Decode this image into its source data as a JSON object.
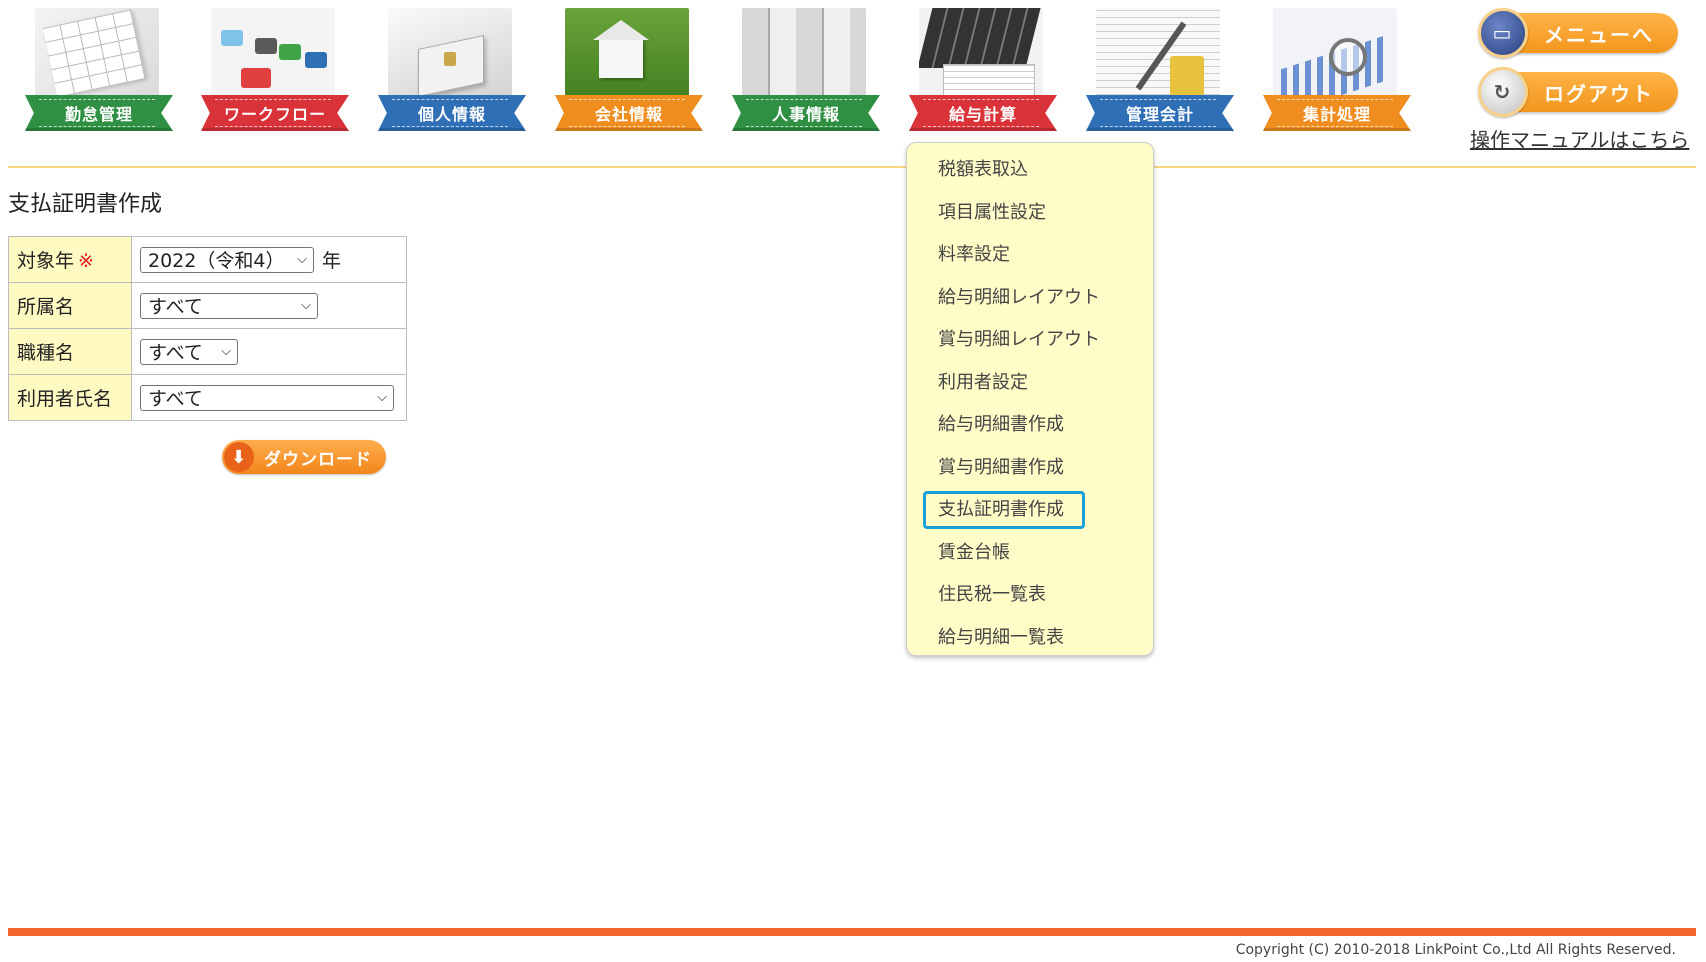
{
  "nav": {
    "tiles": [
      {
        "label": "勤怠管理",
        "color": "#2f8f43",
        "icon": "calendar-icon"
      },
      {
        "label": "ワークフロー",
        "color": "#d93238",
        "icon": "workflow-icon"
      },
      {
        "label": "個人情報",
        "color": "#2f6fb5",
        "icon": "padlock-icon"
      },
      {
        "label": "会社情報",
        "color": "#ef8d1f",
        "icon": "house-icon"
      },
      {
        "label": "人事情報",
        "color": "#2f8f43",
        "icon": "file-cabinet-icon"
      },
      {
        "label": "給与計算",
        "color": "#d93238",
        "icon": "calculator-icon"
      },
      {
        "label": "管理会計",
        "color": "#2f6fb5",
        "icon": "ledger-pen-icon"
      },
      {
        "label": "集計処理",
        "color": "#ef8d1f",
        "icon": "magnifier-chart-icon"
      }
    ]
  },
  "header": {
    "menu_button": "メニューへ",
    "logout_button": "ログアウト",
    "manual_link": "操作マニュアルはこちら"
  },
  "page": {
    "title": "支払証明書作成"
  },
  "form": {
    "year": {
      "label": "対象年",
      "required_mark": "※",
      "value": "2022（令和4）",
      "unit": "年"
    },
    "department": {
      "label": "所属名",
      "value": "すべて"
    },
    "job_type": {
      "label": "職種名",
      "value": "すべて"
    },
    "user_name": {
      "label": "利用者氏名",
      "value": "すべて"
    },
    "download_button": "ダウンロード"
  },
  "dropdown": {
    "parent": "給与計算",
    "items": [
      "税額表取込",
      "項目属性設定",
      "料率設定",
      "給与明細レイアウト",
      "賞与明細レイアウト",
      "利用者設定",
      "給与明細書作成",
      "賞与明細書作成",
      "支払証明書作成",
      "賃金台帳",
      "住民税一覧表",
      "給与明細一覧表"
    ],
    "active_index": 8
  },
  "footer": {
    "copyright": "Copyright (C) 2010-2018 LinkPoint Co.,Ltd All Rights Reserved."
  },
  "colors": {
    "accent_orange": "#f3652a",
    "header_rule": "#f6d77f",
    "label_bg": "#fff9c2",
    "menu_bg": "#fffcc8",
    "active_border": "#1aa0d6"
  }
}
